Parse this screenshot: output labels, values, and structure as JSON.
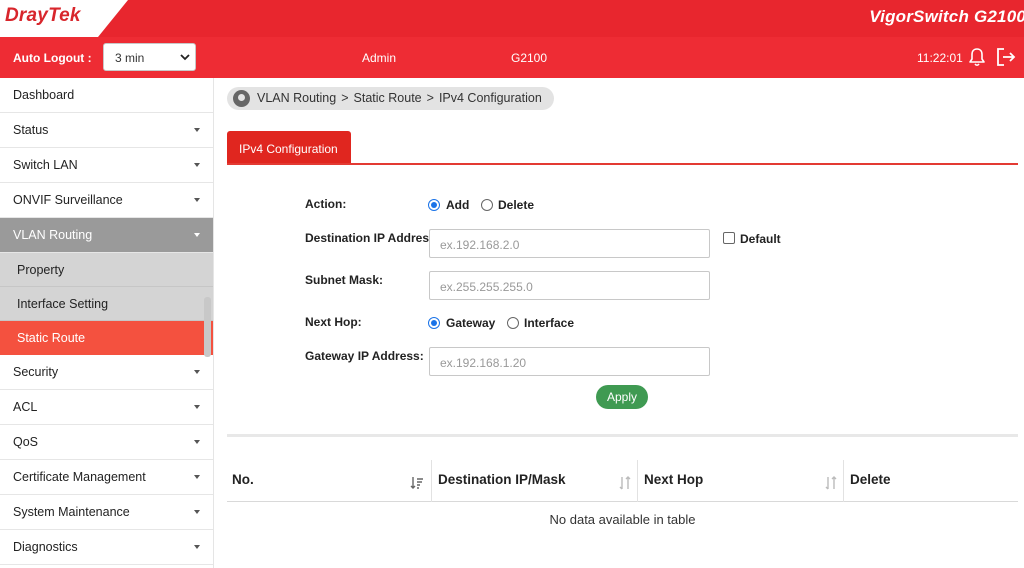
{
  "brand": {
    "logo_dray": "Dray",
    "logo_tek": "Tek",
    "product": "VigorSwitch G2100"
  },
  "header": {
    "auto_logout_label": "Auto Logout :",
    "auto_logout_value": "3 min",
    "user": "Admin",
    "model": "G2100",
    "time": "11:22:01"
  },
  "sidebar": {
    "items": [
      {
        "label": "Dashboard"
      },
      {
        "label": "Status"
      },
      {
        "label": "Switch LAN"
      },
      {
        "label": "ONVIF Surveillance"
      },
      {
        "label": "VLAN Routing"
      },
      {
        "label": "Property"
      },
      {
        "label": "Interface Setting"
      },
      {
        "label": "Static Route"
      },
      {
        "label": "Security"
      },
      {
        "label": "ACL"
      },
      {
        "label": "QoS"
      },
      {
        "label": "Certificate Management"
      },
      {
        "label": "System Maintenance"
      },
      {
        "label": "Diagnostics"
      }
    ]
  },
  "breadcrumb": {
    "part1": "VLAN Routing",
    "sep": ">",
    "part2": "Static Route",
    "part3": "IPv4 Configuration"
  },
  "tab": {
    "label": "IPv4 Configuration"
  },
  "form": {
    "action_label": "Action:",
    "action_add": "Add",
    "action_delete": "Delete",
    "dest_ip_label": "Destination IP Addres",
    "dest_ip_placeholder": "ex.192.168.2.0",
    "default_label": "Default",
    "subnet_label": "Subnet Mask:",
    "subnet_placeholder": "ex.255.255.255.0",
    "next_hop_label": "Next Hop:",
    "next_hop_gateway": "Gateway",
    "next_hop_interface": "Interface",
    "gateway_ip_label": "Gateway IP Address:",
    "gateway_ip_placeholder": "ex.192.168.1.20",
    "apply_label": "Apply"
  },
  "table": {
    "columns": [
      "No.",
      "Destination IP/Mask",
      "Next Hop",
      "Delete"
    ],
    "empty_text": "No data available in table"
  }
}
